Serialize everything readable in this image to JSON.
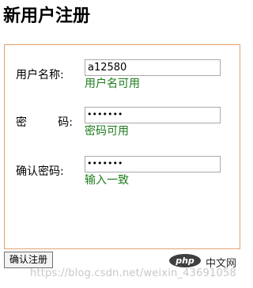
{
  "page_title": "新用户注册",
  "form": {
    "fields": [
      {
        "label": "用户名称:",
        "value": "a12580",
        "hint": "用户名可用"
      },
      {
        "label_chars": [
          "密",
          "码:"
        ],
        "masked_value": "•••••••",
        "hint": "密码可用"
      },
      {
        "label": "确认密码:",
        "masked_value": "•••••••",
        "hint": "输入一致"
      }
    ],
    "submit_label": "确认注册"
  },
  "colors": {
    "border": "#e3a26f",
    "hint_text": "#1c7c1c"
  },
  "branding": {
    "logo_text": "php",
    "site_name": "中文网"
  },
  "watermark": "https://blog.csdn.net/weixin_43691058"
}
